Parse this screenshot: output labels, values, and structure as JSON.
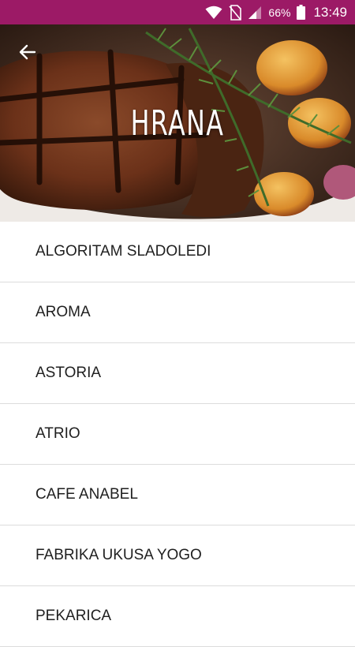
{
  "status_bar": {
    "battery": "66%",
    "time": "13:49"
  },
  "header": {
    "title": "HRANA"
  },
  "colors": {
    "status_bar": "#9c1a66",
    "divider": "#dcdcdc",
    "text": "#1f1f1f"
  },
  "list": {
    "items": [
      {
        "label": "ALGORITAM SLADOLEDI"
      },
      {
        "label": "AROMA"
      },
      {
        "label": "ASTORIA"
      },
      {
        "label": "ATRIO"
      },
      {
        "label": "CAFE ANABEL"
      },
      {
        "label": "FABRIKA UKUSA YOGO"
      },
      {
        "label": "PEKARICA"
      }
    ]
  }
}
